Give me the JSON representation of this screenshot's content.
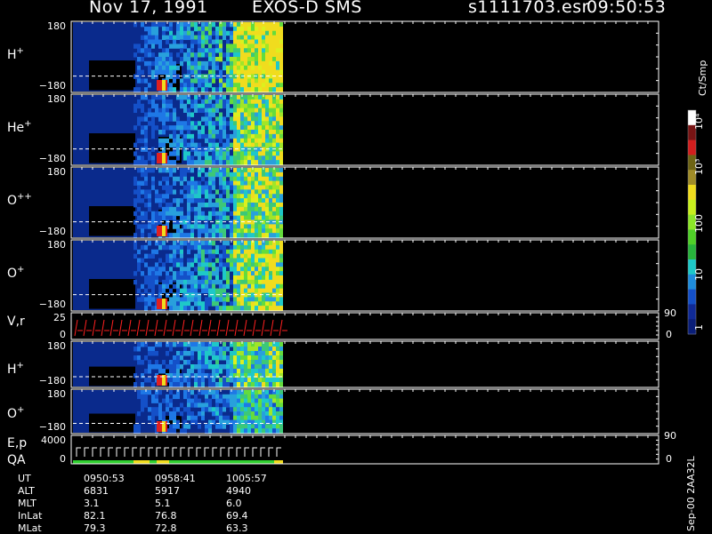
{
  "header": {
    "date": "Nov 17, 1991",
    "instrument": "EXOS-D SMS",
    "file": "s1111703.esr",
    "time": "09:50:53"
  },
  "colorbar": {
    "unit": "Ct/Smp",
    "tick_labels": [
      "1",
      "10",
      "100",
      "10³",
      "10⁴"
    ]
  },
  "side_label": "Sep-00 2AA32L",
  "chart_data": [
    {
      "type": "heatmap",
      "label": "H+",
      "ylim": [
        -180,
        180
      ],
      "y_tick_labels": [
        "180",
        "−180"
      ]
    },
    {
      "type": "heatmap",
      "label": "He+",
      "ylim": [
        -180,
        180
      ],
      "y_tick_labels": [
        "180",
        "−180"
      ]
    },
    {
      "type": "heatmap",
      "label": "O++",
      "ylim": [
        -180,
        180
      ],
      "y_tick_labels": [
        "180",
        "−180"
      ]
    },
    {
      "type": "heatmap",
      "label": "O+",
      "ylim": [
        -180,
        180
      ],
      "y_tick_labels": [
        "180",
        "−180"
      ]
    },
    {
      "type": "line",
      "label": "V,r",
      "ylim": [
        0,
        25
      ],
      "y_tick_labels": [
        "25",
        "0"
      ],
      "right_tick_labels": [
        "90",
        "0"
      ]
    },
    {
      "type": "heatmap",
      "label": "H+",
      "ylim": [
        -180,
        180
      ],
      "y_tick_labels": [
        "180",
        "−180"
      ]
    },
    {
      "type": "heatmap",
      "label": "O+",
      "ylim": [
        -180,
        180
      ],
      "y_tick_labels": [
        "180",
        "−180"
      ]
    },
    {
      "type": "line",
      "label": "E,p QA",
      "ylim": [
        0,
        4000
      ],
      "y_tick_labels": [
        "4000",
        "0"
      ],
      "right_tick_labels": [
        "90",
        "0"
      ]
    }
  ],
  "orbit_table": {
    "rows": [
      {
        "name": "UT",
        "values": [
          "0950:53",
          "0958:41",
          "1005:57"
        ]
      },
      {
        "name": "ALT",
        "values": [
          "6831",
          "5917",
          "4940"
        ]
      },
      {
        "name": "MLT",
        "values": [
          "3.1",
          "5.1",
          "6.0"
        ]
      },
      {
        "name": "InLat",
        "values": [
          "82.1",
          "76.8",
          "69.4"
        ]
      },
      {
        "name": "MLat",
        "values": [
          "79.3",
          "72.8",
          "63.3"
        ]
      }
    ]
  },
  "colors": {
    "background": "#000000",
    "frame": "#ffffff",
    "base": "#0a2a8c",
    "trace": "#ff2020"
  }
}
